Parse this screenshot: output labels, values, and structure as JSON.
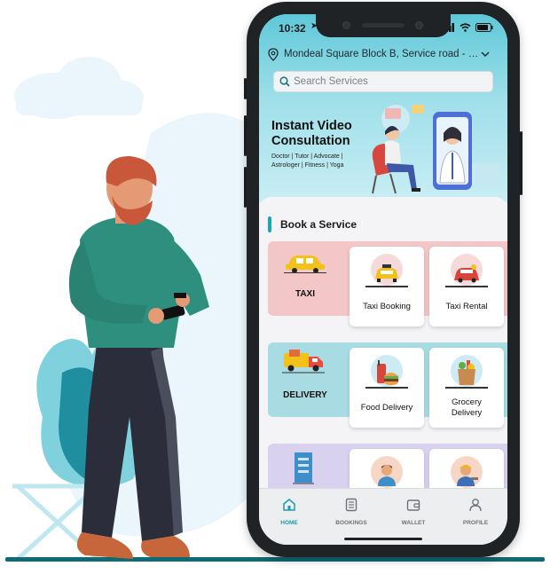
{
  "status_bar": {
    "time": "10:32"
  },
  "location": {
    "address": "Mondeal Square Block B, Service road - S..."
  },
  "search": {
    "placeholder": "Search Services"
  },
  "banner": {
    "title": "Instant Video Consultation",
    "subtitle": "Doctor | Tutor | Advocate | Astrologer | Fitness | Yoga"
  },
  "services": {
    "heading": "Book a Service",
    "rows": [
      {
        "category": "TAXI",
        "cards": [
          "Taxi Booking",
          "Taxi Rental"
        ]
      },
      {
        "category": "DELIVERY",
        "cards": [
          "Food Delivery",
          "Grocery Delivery"
        ]
      },
      {
        "category": "",
        "cards": [
          "",
          ""
        ]
      }
    ]
  },
  "bottom_nav": {
    "items": [
      {
        "label": "HOME",
        "icon": "home-icon",
        "active": true
      },
      {
        "label": "BOOKINGS",
        "icon": "bookings-icon",
        "active": false
      },
      {
        "label": "WALLET",
        "icon": "wallet-icon",
        "active": false
      },
      {
        "label": "PROFILE",
        "icon": "profile-icon",
        "active": false
      }
    ]
  },
  "colors": {
    "accent": "#1aa6b7",
    "taxi_row": "#f3c6c8",
    "delivery_row": "#a9dbe3",
    "third_row": "#d9d2ee",
    "ground": "#0f6b73"
  }
}
